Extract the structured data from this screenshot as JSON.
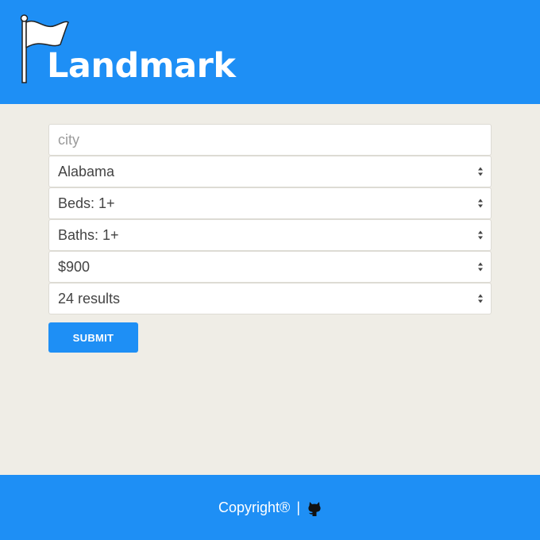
{
  "header": {
    "brand": "Landmark",
    "logo_icon": "flag-icon",
    "background": "#1e8ff5"
  },
  "form": {
    "city_placeholder": "city",
    "city_value": "",
    "state_selected": "Alabama",
    "beds_selected": "Beds: 1+",
    "baths_selected": "Baths: 1+",
    "price_selected": "$900",
    "results_selected": "24 results",
    "submit_label": "SUBMIT"
  },
  "footer": {
    "copyright": "Copyright®",
    "separator": "|",
    "github_icon": "github-icon"
  }
}
